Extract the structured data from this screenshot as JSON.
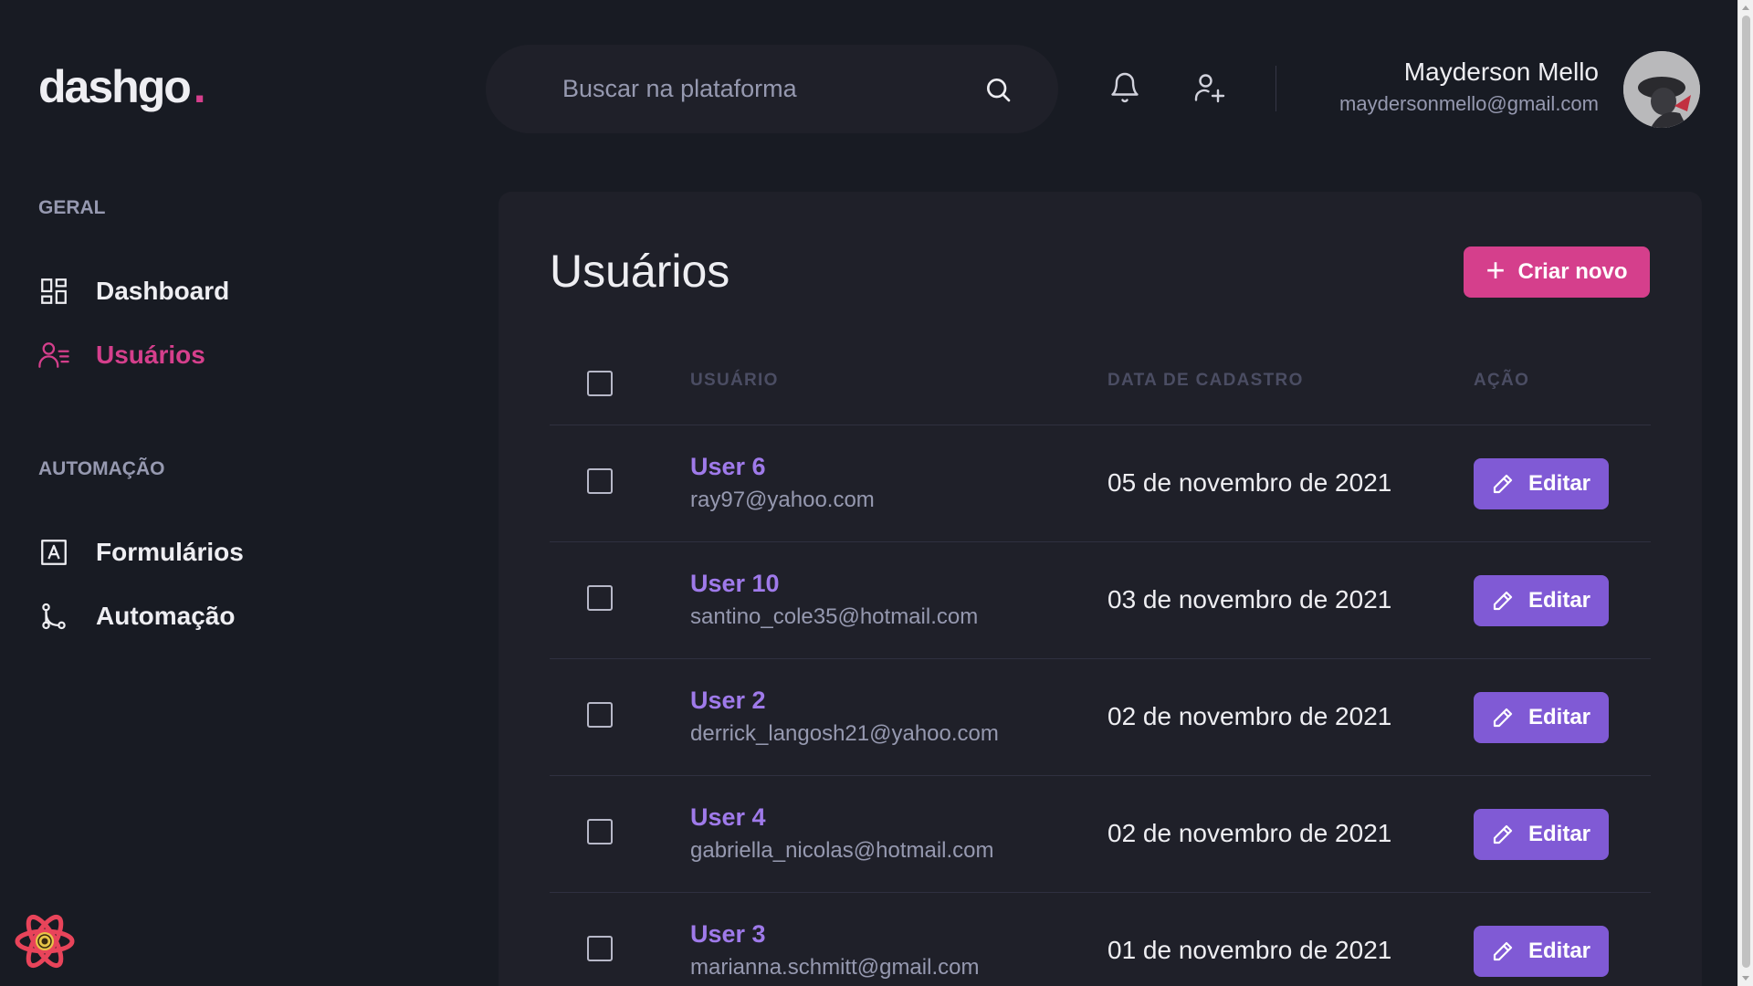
{
  "app": {
    "logo_text": "dashgo",
    "logo_dot": "."
  },
  "header": {
    "search_placeholder": "Buscar na plataforma",
    "icons": [
      "search-icon",
      "bell-icon",
      "user-add-icon"
    ],
    "profile": {
      "name": "Mayderson Mello",
      "email": "maydersonmello@gmail.com"
    }
  },
  "sidebar": {
    "sections": [
      {
        "title": "GERAL",
        "items": [
          {
            "label": "Dashboard",
            "icon": "dashboard-icon",
            "active": false
          },
          {
            "label": "Usuários",
            "icon": "users-icon",
            "active": true
          }
        ]
      },
      {
        "title": "AUTOMAÇÃO",
        "items": [
          {
            "label": "Formulários",
            "icon": "form-icon",
            "active": false
          },
          {
            "label": "Automação",
            "icon": "git-merge-icon",
            "active": false
          }
        ]
      }
    ]
  },
  "main": {
    "title": "Usuários",
    "create_button": "Criar novo",
    "table": {
      "columns": [
        "USUÁRIO",
        "DATA DE CADASTRO",
        "AÇÃO"
      ],
      "edit_label": "Editar",
      "rows": [
        {
          "name": "User 6",
          "email": "ray97@yahoo.com",
          "date": "05 de novembro de 2021"
        },
        {
          "name": "User 10",
          "email": "santino_cole35@hotmail.com",
          "date": "03 de novembro de 2021"
        },
        {
          "name": "User 2",
          "email": "derrick_langosh21@yahoo.com",
          "date": "02 de novembro de 2021"
        },
        {
          "name": "User 4",
          "email": "gabriella_nicolas@hotmail.com",
          "date": "02 de novembro de 2021"
        },
        {
          "name": "User 3",
          "email": "marianna.schmitt@gmail.com",
          "date": "01 de novembro de 2021"
        }
      ]
    }
  },
  "colors": {
    "background": "#181b23",
    "card": "#1f2029",
    "pink": "#d53f8c",
    "purple": "#805ad5",
    "purple_text": "#9f7aea",
    "muted": "#9699b0"
  }
}
